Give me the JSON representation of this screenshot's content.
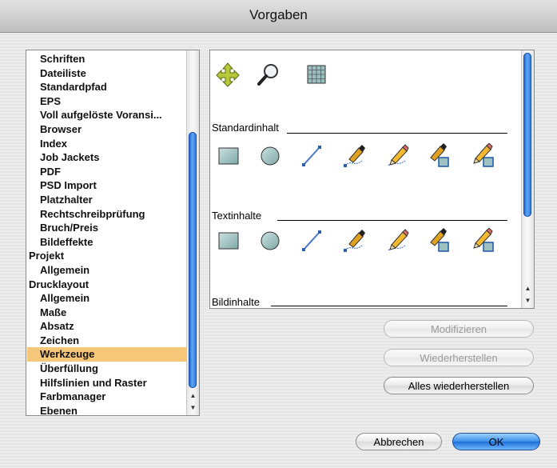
{
  "window": {
    "title": "Vorgaben"
  },
  "sidebar": {
    "items": [
      {
        "label": "Schriften",
        "level": 1
      },
      {
        "label": "Dateiliste",
        "level": 1
      },
      {
        "label": "Standardpfad",
        "level": 1
      },
      {
        "label": "EPS",
        "level": 1
      },
      {
        "label": "Voll aufgelöste Voransi...",
        "level": 1
      },
      {
        "label": "Browser",
        "level": 1
      },
      {
        "label": "Index",
        "level": 1
      },
      {
        "label": "Job Jackets",
        "level": 1
      },
      {
        "label": "PDF",
        "level": 1
      },
      {
        "label": "PSD Import",
        "level": 1
      },
      {
        "label": "Platzhalter",
        "level": 1
      },
      {
        "label": "Rechtschreibprüfung",
        "level": 1
      },
      {
        "label": "Bruch/Preis",
        "level": 1
      },
      {
        "label": "Bildeffekte",
        "level": 1
      },
      {
        "label": "Projekt",
        "level": 0
      },
      {
        "label": "Allgemein",
        "level": 1
      },
      {
        "label": "Drucklayout",
        "level": 0
      },
      {
        "label": "Allgemein",
        "level": 1
      },
      {
        "label": "Maße",
        "level": 1
      },
      {
        "label": "Absatz",
        "level": 1
      },
      {
        "label": "Zeichen",
        "level": 1
      },
      {
        "label": "Werkzeuge",
        "level": 1,
        "selected": true
      },
      {
        "label": "Überfüllung",
        "level": 1
      },
      {
        "label": "Hilfslinien und Raster",
        "level": 1
      },
      {
        "label": "Farbmanager",
        "level": 1
      },
      {
        "label": "Ebenen",
        "level": 1
      }
    ]
  },
  "tools": {
    "top_icons": [
      "move-tool-icon",
      "zoom-tool-icon",
      "table-tool-icon"
    ],
    "sections": [
      {
        "title": "Standardinhalt",
        "icons": [
          "rectangle-box-icon",
          "oval-box-icon",
          "line-tool-icon",
          "bezier-pen-icon",
          "freehand-pencil-icon",
          "bezier-box-pen-icon",
          "freehand-box-pencil-icon"
        ]
      },
      {
        "title": "Textinhalte",
        "icons": [
          "rectangle-box-icon",
          "oval-box-icon",
          "line-tool-icon",
          "bezier-pen-icon",
          "freehand-pencil-icon",
          "bezier-box-pen-icon",
          "freehand-box-pencil-icon"
        ]
      },
      {
        "title": "Bildinhalte",
        "icons": []
      }
    ]
  },
  "buttons": {
    "modify": "Modifizieren",
    "restore": "Wiederherstellen",
    "restore_all": "Alles wiederherstellen",
    "cancel": "Abbrechen",
    "ok": "OK"
  },
  "colors": {
    "selection": "#f6c778",
    "scroll_thumb": "#2a76df",
    "default_button": "#3a8fe6"
  }
}
